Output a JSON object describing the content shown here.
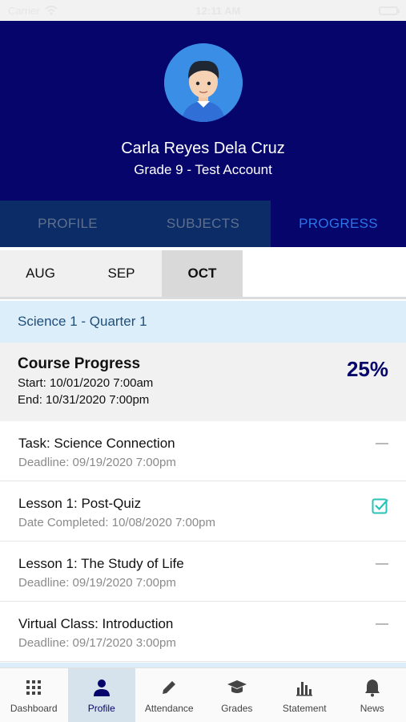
{
  "status_bar": {
    "carrier": "Carrier",
    "time": "12:11 AM"
  },
  "profile": {
    "name": "Carla Reyes Dela Cruz",
    "grade": "Grade 9 - Test Account"
  },
  "tabs": [
    {
      "label": "PROFILE"
    },
    {
      "label": "SUBJECTS"
    },
    {
      "label": "PROGRESS"
    }
  ],
  "months": [
    {
      "label": "AUG"
    },
    {
      "label": "SEP"
    },
    {
      "label": "OCT"
    }
  ],
  "section": {
    "title": "Science 1 - Quarter 1"
  },
  "course_progress": {
    "title": "Course Progress",
    "start": "Start: 10/01/2020 7:00am",
    "end": "End: 10/31/2020 7:00pm",
    "percent": "25%"
  },
  "tasks": [
    {
      "title": "Task: Science Connection",
      "sub": "Deadline: 09/19/2020 7:00pm",
      "status_icon": "dash-icon"
    },
    {
      "title": "Lesson 1: Post-Quiz",
      "sub": "Date Completed: 10/08/2020 7:00pm",
      "status_icon": "checked-box-icon"
    },
    {
      "title": "Lesson 1: The Study of Life",
      "sub": "Deadline: 09/19/2020 7:00pm",
      "status_icon": "dash-icon"
    },
    {
      "title": "Virtual Class: Introduction",
      "sub": "Deadline: 09/17/2020 3:00pm",
      "status_icon": "dash-icon"
    }
  ],
  "bottom_nav": [
    {
      "label": "Dashboard",
      "icon": "grid-icon"
    },
    {
      "label": "Profile",
      "icon": "person-icon"
    },
    {
      "label": "Attendance",
      "icon": "pencil-icon"
    },
    {
      "label": "Grades",
      "icon": "graduation-cap-icon"
    },
    {
      "label": "Statement",
      "icon": "bar-chart-icon"
    },
    {
      "label": "News",
      "icon": "bell-icon"
    }
  ],
  "colors": {
    "header": "#05056b",
    "accent": "#2d74e8",
    "check": "#27c4b5"
  }
}
